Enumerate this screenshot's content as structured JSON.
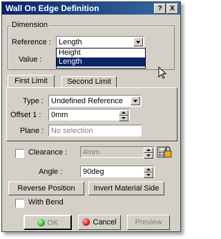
{
  "window": {
    "title": "Wall On Edge Definition"
  },
  "titlebar": {
    "help_label": "?",
    "close_label": "X"
  },
  "dimension": {
    "legend": "Dimension",
    "reference_label": "Reference :",
    "reference_value": "Length",
    "value_label": "Value :",
    "options": [
      "Height",
      "Length"
    ],
    "selected_option": "Length"
  },
  "tabs": {
    "first_limit": "First Limit",
    "second_limit": "Second Limit"
  },
  "first_limit": {
    "type_label": "Type :",
    "type_value": "Undefined Reference",
    "offset_label": "Offset 1 :",
    "offset_value": "0mm",
    "plane_label": "Plane :",
    "plane_value": "No selection"
  },
  "clearance": {
    "label": "Clearance :",
    "value": "4mm"
  },
  "angle": {
    "label": "Angle :",
    "value": "90deg"
  },
  "buttons": {
    "reverse_position": "Reverse Position",
    "invert_material_side": "Invert Material Side"
  },
  "with_bend": {
    "label": "With Bend"
  },
  "footer": {
    "ok": "OK",
    "cancel": "Cancel",
    "preview": "Preview"
  },
  "colors": {
    "title_start": "#0a246a",
    "title_end": "#3a6ea5",
    "ok_dot": "#2fb52f",
    "cancel_dot": "#d02020"
  }
}
